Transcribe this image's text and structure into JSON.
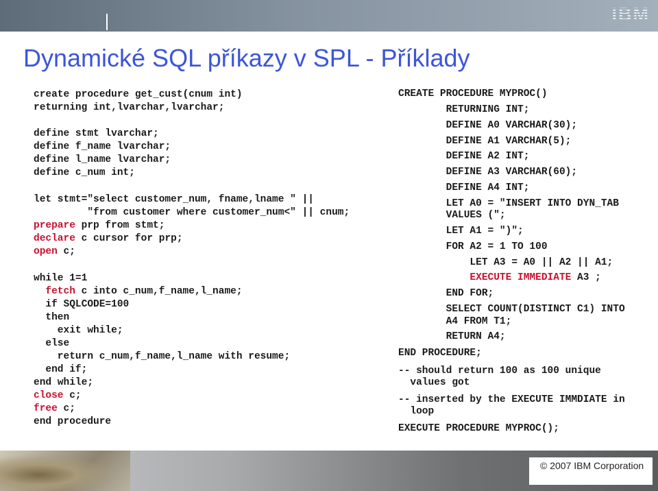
{
  "header": {
    "logo_text": "IBM"
  },
  "title": "Dynamické SQL příkazy v SPL - Příklady",
  "left_code": {
    "lines": [
      [
        {
          "t": "create procedure get_cust(cnum int)"
        }
      ],
      [
        {
          "t": "returning int,lvarchar,lvarchar;"
        }
      ],
      [
        {
          "t": "define stmt lvarchar;"
        }
      ],
      [
        {
          "t": "define f_name lvarchar;"
        }
      ],
      [
        {
          "t": "define l_name lvarchar;"
        }
      ],
      [
        {
          "t": "define c_num int;"
        }
      ],
      [
        {
          "t": "let stmt=\"select customer_num, fname,lname \" ||"
        }
      ],
      [
        {
          "t": "         \"from customer where customer_num<\" || cnum;"
        }
      ],
      [
        {
          "t": "prepare",
          "red": true
        },
        {
          "t": " prp from stmt;"
        }
      ],
      [
        {
          "t": "declare",
          "red": true
        },
        {
          "t": " c cursor for prp;"
        }
      ],
      [
        {
          "t": "open",
          "red": true
        },
        {
          "t": " c;"
        }
      ],
      [
        {
          "t": "while 1=1"
        }
      ],
      [
        {
          "t": "  "
        },
        {
          "t": "fetch",
          "red": true
        },
        {
          "t": " c into c_num,f_name,l_name;"
        }
      ],
      [
        {
          "t": "  if SQLCODE=100"
        }
      ],
      [
        {
          "t": "  then"
        }
      ],
      [
        {
          "t": "    exit while;"
        }
      ],
      [
        {
          "t": "  else"
        }
      ],
      [
        {
          "t": "    return c_num,f_name,l_name with resume;"
        }
      ],
      [
        {
          "t": "  end if;"
        }
      ],
      [
        {
          "t": "end while;"
        }
      ],
      [
        {
          "t": "close",
          "red": true
        },
        {
          "t": " c;"
        }
      ],
      [
        {
          "t": "free",
          "red": true
        },
        {
          "t": " c;"
        }
      ],
      [
        {
          "t": "end procedure"
        }
      ]
    ]
  },
  "right_code": {
    "lines": [
      [
        {
          "t": "CREATE PROCEDURE MYPROC()"
        }
      ],
      [
        {
          "t": "        RETURNING INT;"
        }
      ],
      [
        {
          "t": "        DEFINE A0 VARCHAR(30);"
        }
      ],
      [
        {
          "t": "        DEFINE A1 VARCHAR(5);"
        }
      ],
      [
        {
          "t": "        DEFINE A2 INT;"
        }
      ],
      [
        {
          "t": "        DEFINE A3 VARCHAR(60);"
        }
      ],
      [
        {
          "t": "        DEFINE A4 INT;"
        }
      ],
      [
        {
          "t": "        LET A0 = \"INSERT INTO DYN_TAB"
        }
      ],
      [
        {
          "t": "        VALUES (\";"
        }
      ],
      [
        {
          "t": "        LET A1 = \")\";"
        }
      ],
      [
        {
          "t": "        FOR A2 = 1 TO 100"
        }
      ],
      [
        {
          "t": "            LET A3 = A0 || A2 || A1;"
        }
      ],
      [
        {
          "t": "            "
        },
        {
          "t": "EXECUTE IMMEDIATE",
          "red": true
        },
        {
          "t": " A3 ;"
        }
      ],
      [
        {
          "t": "        END FOR;"
        }
      ],
      [
        {
          "t": "        SELECT COUNT(DISTINCT C1) INTO"
        }
      ],
      [
        {
          "t": "        A4 FROM T1;"
        }
      ],
      [
        {
          "t": "        RETURN A4;"
        }
      ],
      [
        {
          "t": "END PROCEDURE;"
        }
      ],
      [
        {
          "t": "-- should return 100 as 100 unique"
        }
      ],
      [
        {
          "t": "  values got"
        }
      ],
      [
        {
          "t": "-- inserted by the EXECUTE IMMDIATE in"
        }
      ],
      [
        {
          "t": "  loop"
        }
      ],
      [
        {
          "t": "EXECUTE PROCEDURE MYPROC();"
        }
      ]
    ]
  },
  "footer": {
    "copyright": "© 2007 IBM Corporation"
  }
}
